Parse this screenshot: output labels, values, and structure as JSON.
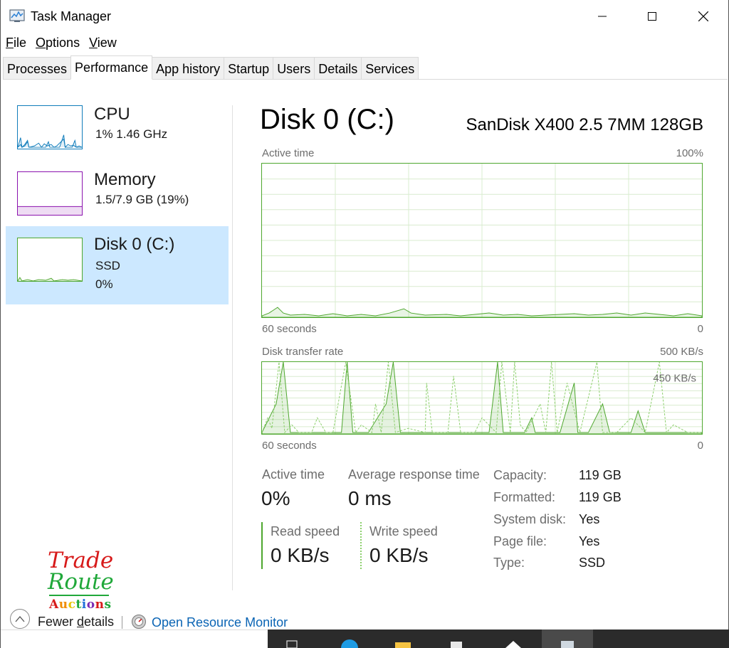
{
  "window": {
    "title": "Task Manager"
  },
  "menu": {
    "file": "File",
    "options": "Options",
    "view": "View"
  },
  "tabs": [
    "Processes",
    "Performance",
    "App history",
    "Startup",
    "Users",
    "Details",
    "Services"
  ],
  "sidebar": {
    "items": [
      {
        "name": "CPU",
        "sub1": "1%  1.46 GHz",
        "color": "#117dbb"
      },
      {
        "name": "Memory",
        "sub1": "1.5/7.9 GB (19%)",
        "color": "#8b12ae"
      },
      {
        "name": "Disk 0 (C:)",
        "sub1": "SSD",
        "sub2": "0%",
        "color": "#4ea72e"
      }
    ]
  },
  "disk": {
    "title": "Disk 0 (C:)",
    "model": "SanDisk X400 2.5 7MM 128GB",
    "active_chart": {
      "label": "Active time",
      "max": "100%",
      "x_left": "60 seconds",
      "x_right": "0"
    },
    "transfer_chart": {
      "label": "Disk transfer rate",
      "max": "500 KB/s",
      "marker": "450 KB/s",
      "x_left": "60 seconds",
      "x_right": "0"
    },
    "stats": {
      "active_time_label": "Active time",
      "active_time_value": "0%",
      "avg_resp_label": "Average response time",
      "avg_resp_value": "0 ms",
      "read_label": "Read speed",
      "read_value": "0 KB/s",
      "write_label": "Write speed",
      "write_value": "0 KB/s"
    },
    "properties": [
      {
        "label": "Capacity:",
        "value": "119 GB"
      },
      {
        "label": "Formatted:",
        "value": "119 GB"
      },
      {
        "label": "System disk:",
        "value": "Yes"
      },
      {
        "label": "Page file:",
        "value": "Yes"
      },
      {
        "label": "Type:",
        "value": "SSD"
      }
    ]
  },
  "footer": {
    "fewer_details": "Fewer details",
    "open_monitor": "Open Resource Monitor"
  },
  "logo": {
    "line1": "Trade",
    "line2": "Route",
    "line3": "Auctions"
  },
  "colors": {
    "accent_green": "#4ea72e",
    "selection": "#cce8ff",
    "link": "#0a64b4"
  }
}
